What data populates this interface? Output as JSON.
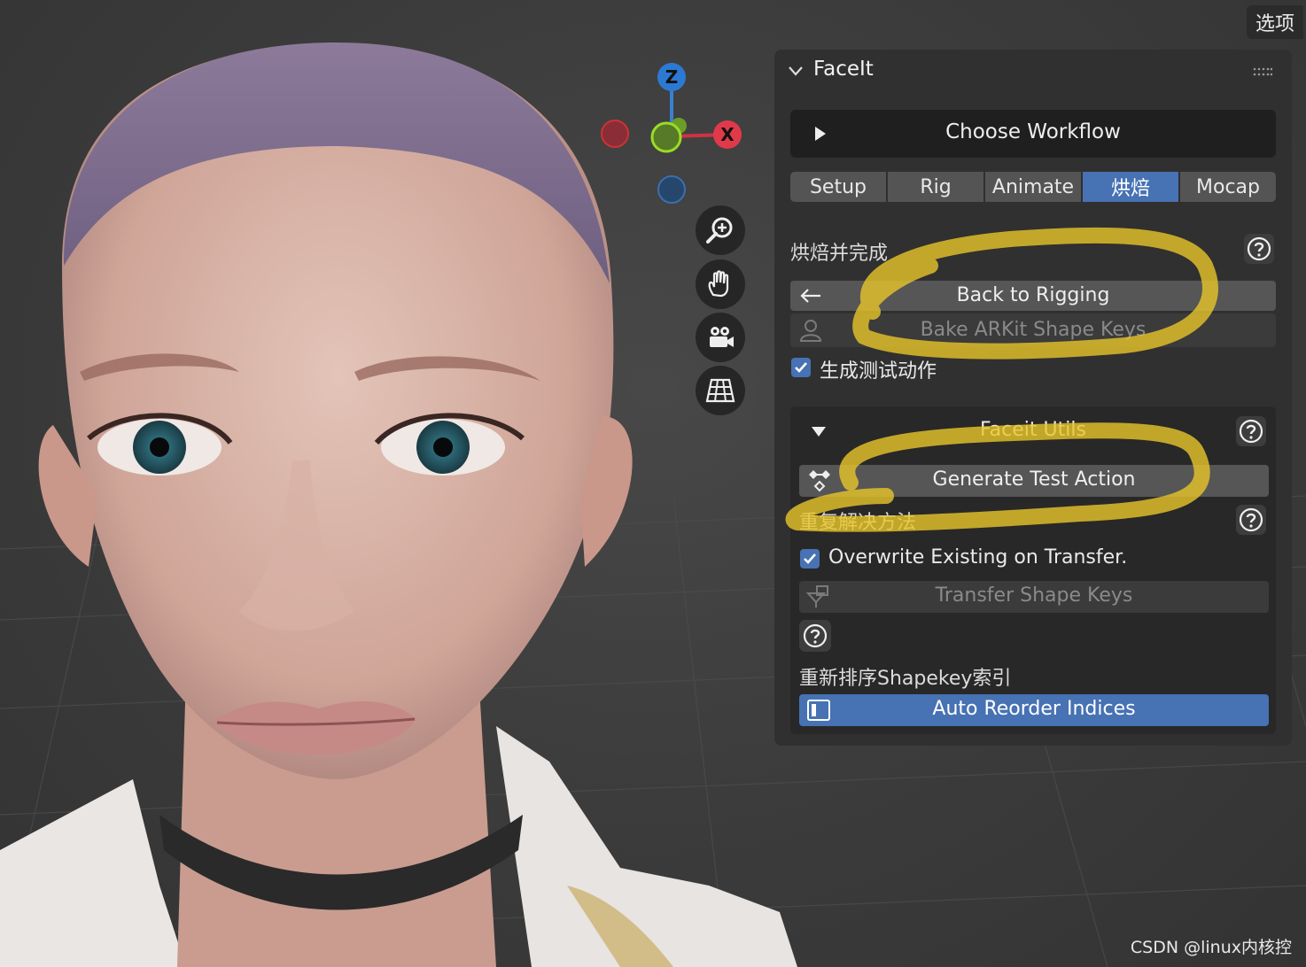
{
  "options_tab": "选项",
  "gizmo": {
    "z": "Z",
    "x": "X"
  },
  "tools": {
    "zoom": "zoom-icon",
    "pan": "hand-icon",
    "camera": "camera-icon",
    "view": "grid-icon"
  },
  "panel": {
    "title": "FaceIt",
    "choose_workflow": "Choose Workflow",
    "tabs": [
      "Setup",
      "Rig",
      "Animate",
      "烘焙",
      "Mocap"
    ],
    "active_tab": "烘焙",
    "bake_section": {
      "label": "烘焙并完成",
      "back_button": "Back to Rigging",
      "bake_button": "Bake ARKit Shape Keys",
      "generate_test_checkbox": "生成测试动作",
      "generate_test_checked": true
    },
    "utils": {
      "title": "Faceit Utils",
      "generate_action": "Generate Test Action",
      "overwrite_label": "重复解决方法",
      "overwrite_checkbox": "Overwrite Existing on Transfer.",
      "overwrite_checked": true,
      "transfer_button": "Transfer Shape Keys",
      "reorder_label": "重新排序Shapekey索引",
      "reorder_button": "Auto Reorder Indices"
    }
  },
  "watermark": "CSDN @linux内核控",
  "colors": {
    "accent": "#4772b3",
    "panel": "#303030",
    "annotation": "#e8c62a"
  }
}
